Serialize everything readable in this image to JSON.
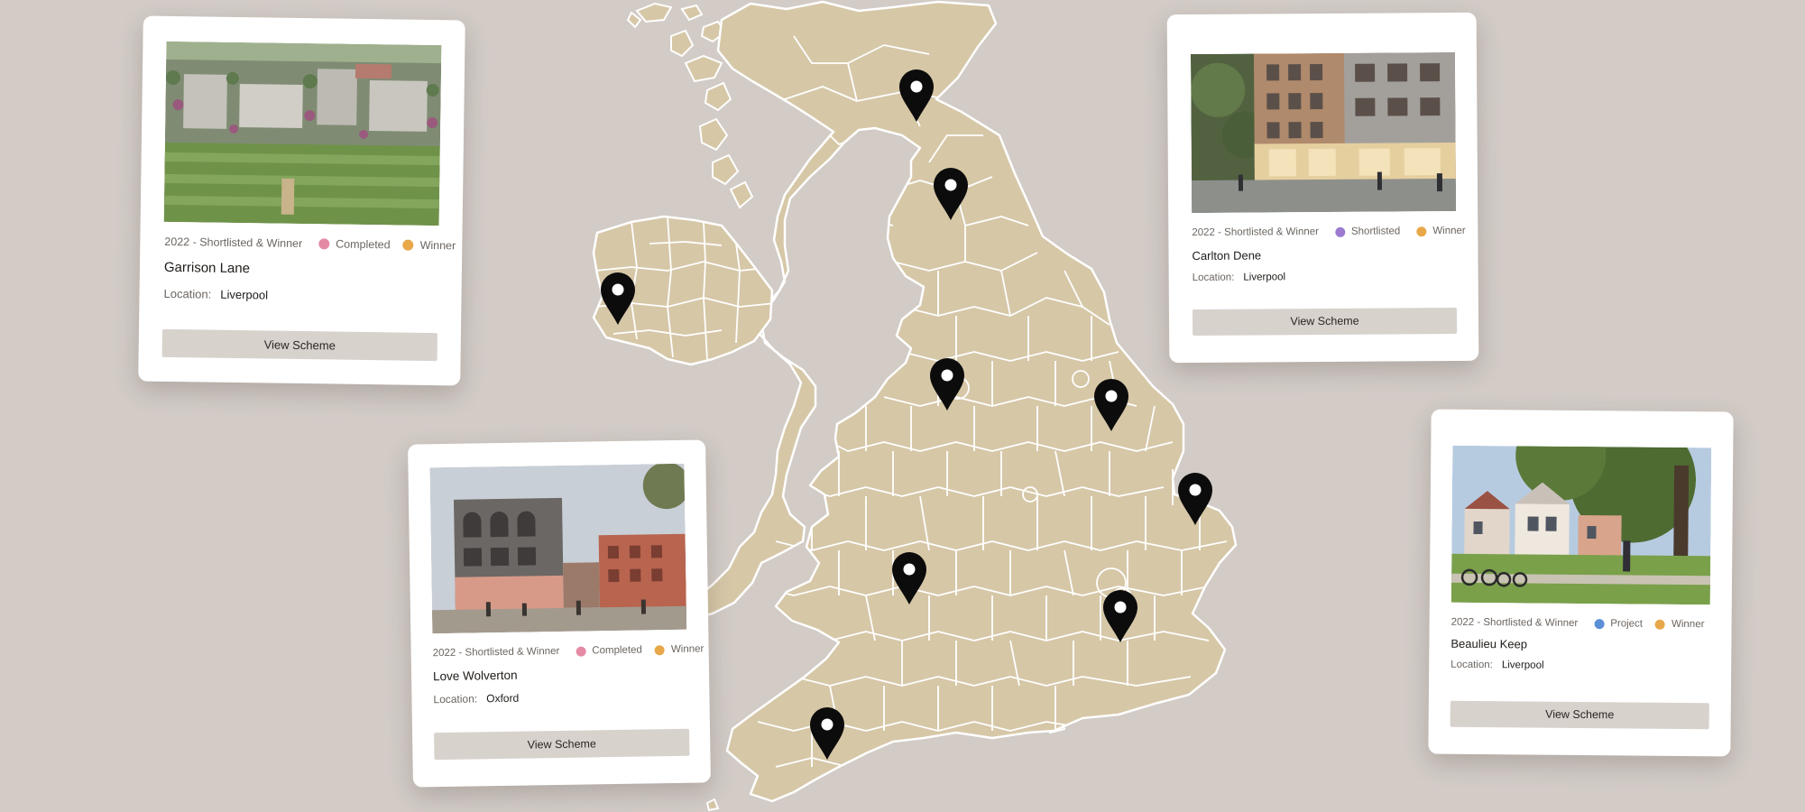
{
  "colors": {
    "background": "#d2cbc6",
    "land": "#d6c7a7",
    "border": "#ffffff",
    "pin": "#0c0c0c",
    "completed": "#e58aa5",
    "winner": "#e8a84a",
    "shortlisted": "#9b7ad0",
    "project": "#5b8fd6",
    "button": "#d8d2cd"
  },
  "map": {
    "name": "uk-map",
    "pin_icon": "map-pin-icon"
  },
  "cards": [
    {
      "id": "garrison-lane",
      "year_label": "2022 - Shortlisted & Winner",
      "tags": [
        {
          "label": "Completed",
          "color": "#e58aa5"
        },
        {
          "label": "Winner",
          "color": "#e8a84a"
        }
      ],
      "name": "Garrison Lane",
      "location_label": "Location:",
      "location": "Liverpool",
      "button_label": "View Scheme"
    },
    {
      "id": "carlton-dene",
      "year_label": "2022 - Shortlisted & Winner",
      "tags": [
        {
          "label": "Shortlisted",
          "color": "#9b7ad0"
        },
        {
          "label": "Winner",
          "color": "#e8a84a"
        }
      ],
      "name": "Carlton Dene",
      "location_label": "Location:",
      "location": "Liverpool",
      "button_label": "View Scheme"
    },
    {
      "id": "love-wolverton",
      "year_label": "2022 - Shortlisted & Winner",
      "tags": [
        {
          "label": "Completed",
          "color": "#e58aa5"
        },
        {
          "label": "Winner",
          "color": "#e8a84a"
        }
      ],
      "name": "Love Wolverton",
      "location_label": "Location:",
      "location": "Oxford",
      "button_label": "View Scheme"
    },
    {
      "id": "beaulieu-keep",
      "year_label": "2022 - Shortlisted & Winner",
      "tags": [
        {
          "label": "Project",
          "color": "#5b8fd6"
        },
        {
          "label": "Winner",
          "color": "#e8a84a"
        }
      ],
      "name": "Beaulieu Keep",
      "location_label": "Location:",
      "location": "Liverpool",
      "button_label": "View Scheme"
    }
  ]
}
